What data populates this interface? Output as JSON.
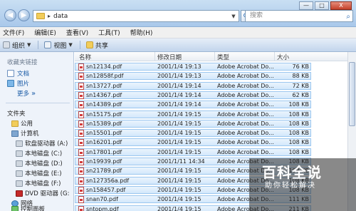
{
  "window": {
    "address_path": "data",
    "search_placeholder": "搜索",
    "minimize": "—",
    "maximize": "□",
    "close": "X"
  },
  "menu": [
    "文件(F)",
    "编辑(E)",
    "查看(V)",
    "工具(T)",
    "帮助(H)"
  ],
  "toolbar": {
    "organize": "组织",
    "views": "视图",
    "share": "共享"
  },
  "nav": {
    "favorites_header": "收藏夹链接",
    "favorites": [
      "文档",
      "图片"
    ],
    "more": "更多",
    "more_glyph": "»",
    "folders_header": "文件夹",
    "tree": [
      "公用",
      "计算机",
      "软盘驱动器 (A:)",
      "本地磁盘 (C:)",
      "本地磁盘 (D:)",
      "本地磁盘 (E:)",
      "本地磁盘 (F:)",
      "DVD 驱动器 (G:",
      "网络",
      "控制面板"
    ]
  },
  "columns": {
    "name": "名称",
    "date": "修改日期",
    "type": "类型",
    "size": "大小"
  },
  "files": [
    {
      "name": "sn12134.pdf",
      "date": "2001/1/4 19:13",
      "type": "Adobe Acrobat Do...",
      "size": "76 KB"
    },
    {
      "name": "sn12858f.pdf",
      "date": "2001/1/4 19:13",
      "type": "Adobe Acrobat Do...",
      "size": "88 KB"
    },
    {
      "name": "sn13727.pdf",
      "date": "2001/1/4 19:14",
      "type": "Adobe Acrobat Do...",
      "size": "72 KB"
    },
    {
      "name": "sn14367.pdf",
      "date": "2001/1/4 19:14",
      "type": "Adobe Acrobat Do...",
      "size": "62 KB"
    },
    {
      "name": "sn14389.pdf",
      "date": "2001/1/4 19:14",
      "type": "Adobe Acrobat Do...",
      "size": "108 KB"
    },
    {
      "name": "sn15175.pdf",
      "date": "2001/1/4 19:15",
      "type": "Adobe Acrobat Do...",
      "size": "108 KB"
    },
    {
      "name": "sn15389.pdf",
      "date": "2001/1/4 19:15",
      "type": "Adobe Acrobat Do...",
      "size": "108 KB"
    },
    {
      "name": "sn15501.pdf",
      "date": "2001/1/4 19:15",
      "type": "Adobe Acrobat Do...",
      "size": "108 KB"
    },
    {
      "name": "sn16201.pdf",
      "date": "2001/1/4 19:15",
      "type": "Adobe Acrobat Do...",
      "size": "108 KB"
    },
    {
      "name": "sn17801.pdf",
      "date": "2001/1/4 19:15",
      "type": "Adobe Acrobat Do...",
      "size": "108 KB"
    },
    {
      "name": "sn19939.pdf",
      "date": "2001/1/11 14:34",
      "type": "Adobe Acrobat Do...",
      "size": "108 KB"
    },
    {
      "name": "sn21789.pdf",
      "date": "2001/1/4 19:15",
      "type": "Adobe Acrobat Do...",
      "size": "108 KB"
    },
    {
      "name": "sn127356a.pdf",
      "date": "2001/1/4 19:15",
      "type": "Adobe Acrobat Do...",
      "size": "108 KB"
    },
    {
      "name": "sn158457.pdf",
      "date": "2001/1/4 19:15",
      "type": "Adobe Acrobat Do...",
      "size": "108 KB"
    },
    {
      "name": "snan70.pdf",
      "date": "2001/1/4 19:15",
      "type": "Adobe Acrobat Do...",
      "size": "111 KB"
    },
    {
      "name": "sntopm.pdf",
      "date": "2001/1/4 19:15",
      "type": "Adobe Acrobat Do...",
      "size": "211 KB"
    }
  ],
  "watermark": {
    "title": "百科全说",
    "subtitle": "助你轻松解决"
  }
}
